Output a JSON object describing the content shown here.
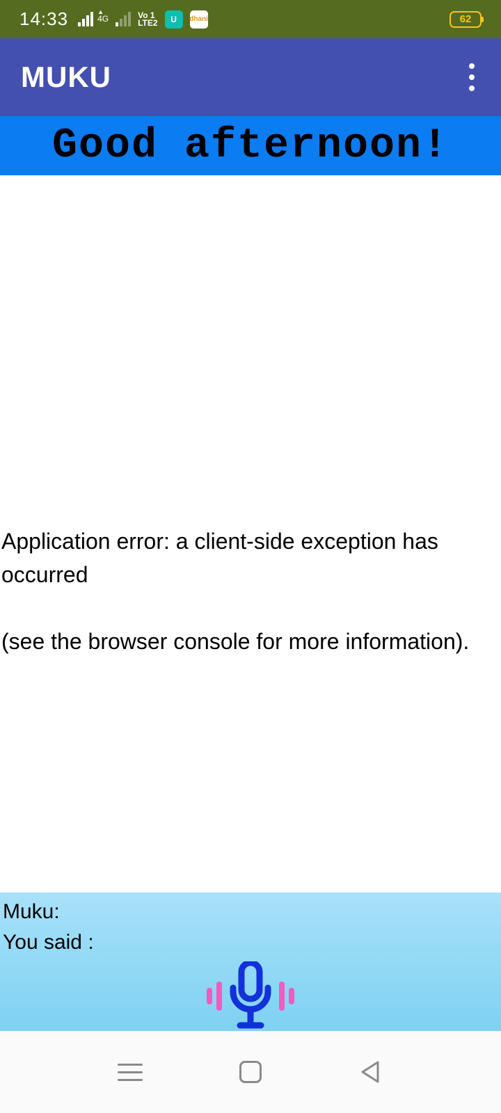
{
  "status": {
    "time": "14:33",
    "net_label_top": "4G",
    "volte_top": "Vo 1",
    "volte_bot": "LTE2",
    "app_icon_1": "U",
    "app_icon_2": "dhani",
    "battery": "62"
  },
  "appbar": {
    "title": "MUKU"
  },
  "greeting": {
    "text": "Good afternoon!"
  },
  "main": {
    "error_line1": "Application error: a client-side exception has occurred",
    "error_line2": "(see the browser console for more information)."
  },
  "bottom": {
    "muku_label": "Muku:",
    "you_said_label": "You said :"
  }
}
